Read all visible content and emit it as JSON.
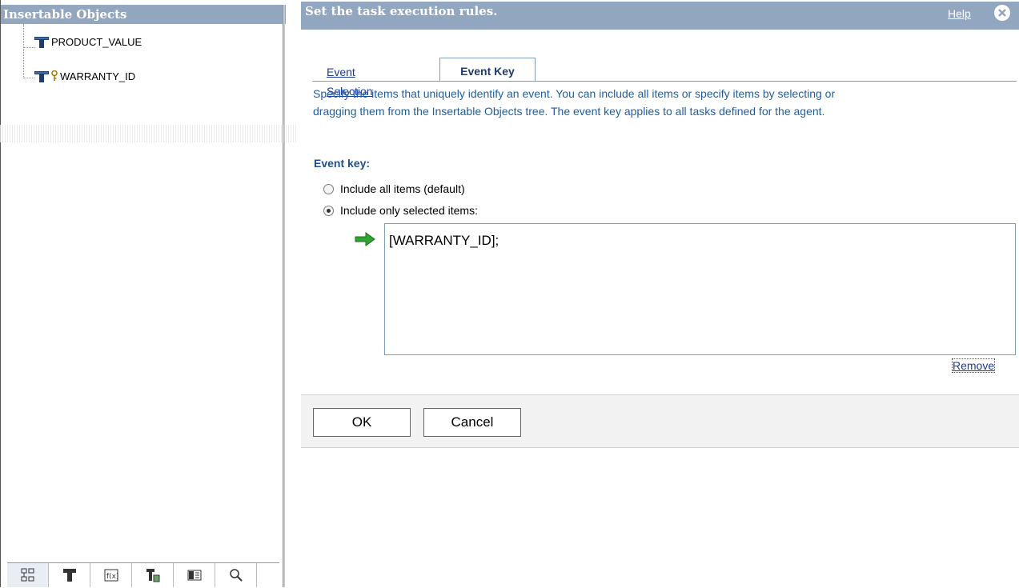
{
  "left_panel": {
    "title": "Insertable Objects",
    "tree": [
      {
        "label": "PRODUCT_VALUE",
        "icon": "table-column-icon",
        "is_key": false
      },
      {
        "label": "WARRANTY_ID",
        "icon": "table-column-icon",
        "is_key": true
      }
    ],
    "bottom_tabs": [
      "tree-view-icon",
      "table-icon",
      "function-icon",
      "table-edit-icon",
      "panel-icon",
      "search-icon"
    ]
  },
  "dialog": {
    "title": "Set the task execution rules.",
    "help_label": "Help",
    "tabs": [
      {
        "label": "Event Selection",
        "active": false
      },
      {
        "label": "Event Key",
        "active": true
      }
    ],
    "description_line1": "Specify the items that uniquely identify an event. You can include all items or specify items by selecting or",
    "description_line2": "dragging them from the Insertable Objects tree. The event key applies to all tasks defined for the agent.",
    "event_key_label": "Event key:",
    "option_all": "Include all items (default)",
    "option_selected": "Include only selected items:",
    "selected_option": "selected",
    "key_value": "[WARRANTY_ID];",
    "remove_label": "Remove",
    "ok_label": "OK",
    "cancel_label": "Cancel"
  },
  "colors": {
    "header_bg": "#93a6c0",
    "description_text": "#1f5fa0",
    "link": "#1a3b9a",
    "arrow_green": "#2fa52f"
  }
}
